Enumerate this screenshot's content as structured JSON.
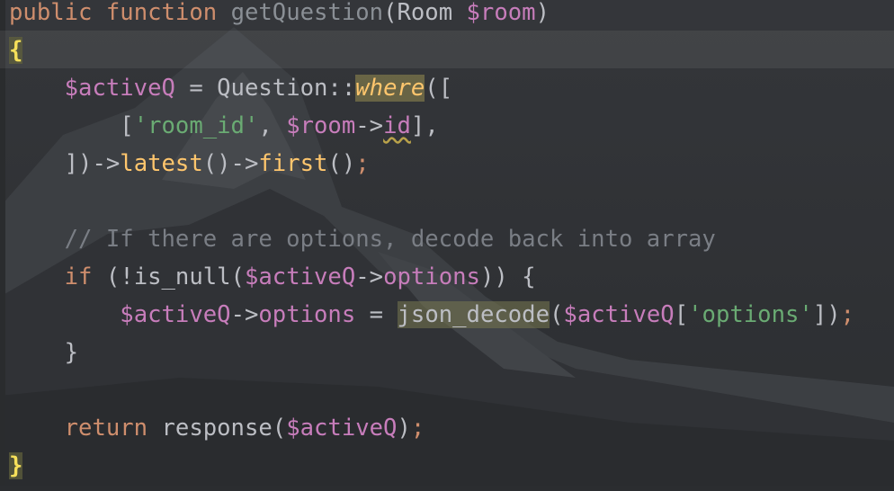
{
  "editor": {
    "lines": [
      {
        "tokens": [
          {
            "t": "public ",
            "c": "kw"
          },
          {
            "t": "function ",
            "c": "kw"
          },
          {
            "t": "getQuestion",
            "c": "fn-decl"
          },
          {
            "t": "(Room ",
            "c": ""
          },
          {
            "t": "$room",
            "c": "var"
          },
          {
            "t": ")",
            "c": ""
          }
        ]
      },
      {
        "tokens": [
          {
            "t": "{",
            "c": "brace"
          }
        ]
      },
      {
        "tokens": [
          {
            "t": "    ",
            "c": ""
          },
          {
            "t": "$activeQ",
            "c": "var"
          },
          {
            "t": " = Question::",
            "c": ""
          },
          {
            "t": "where",
            "c": "call-hl"
          },
          {
            "t": "([",
            "c": ""
          }
        ]
      },
      {
        "tokens": [
          {
            "t": "        [",
            "c": ""
          },
          {
            "t": "'room_id'",
            "c": "str"
          },
          {
            "t": ", ",
            "c": ""
          },
          {
            "t": "$room",
            "c": "var"
          },
          {
            "t": "->",
            "c": ""
          },
          {
            "t": "id",
            "c": "prop squig"
          },
          {
            "t": "],",
            "c": ""
          }
        ]
      },
      {
        "tokens": [
          {
            "t": "    ])->",
            "c": ""
          },
          {
            "t": "latest",
            "c": "call"
          },
          {
            "t": "()->",
            "c": ""
          },
          {
            "t": "first",
            "c": "call"
          },
          {
            "t": "()",
            "c": ""
          },
          {
            "t": ";",
            "c": "punct-or"
          }
        ]
      },
      {
        "tokens": []
      },
      {
        "tokens": [
          {
            "t": "    // If there are options, decode back into array",
            "c": "cmt"
          }
        ]
      },
      {
        "tokens": [
          {
            "t": "    ",
            "c": ""
          },
          {
            "t": "if",
            "c": "kw"
          },
          {
            "t": " (!is_null(",
            "c": ""
          },
          {
            "t": "$activeQ",
            "c": "var"
          },
          {
            "t": "->",
            "c": ""
          },
          {
            "t": "options",
            "c": "prop"
          },
          {
            "t": ")) {",
            "c": ""
          }
        ]
      },
      {
        "tokens": [
          {
            "t": "        ",
            "c": ""
          },
          {
            "t": "$activeQ",
            "c": "var"
          },
          {
            "t": "->",
            "c": ""
          },
          {
            "t": "options",
            "c": "prop"
          },
          {
            "t": " = ",
            "c": ""
          },
          {
            "t": "json_decode",
            "c": "hl"
          },
          {
            "t": "(",
            "c": ""
          },
          {
            "t": "$activeQ",
            "c": "var"
          },
          {
            "t": "[",
            "c": ""
          },
          {
            "t": "'options'",
            "c": "str"
          },
          {
            "t": "])",
            "c": ""
          },
          {
            "t": ";",
            "c": "punct-or"
          }
        ]
      },
      {
        "tokens": [
          {
            "t": "    }",
            "c": ""
          }
        ]
      },
      {
        "tokens": []
      },
      {
        "tokens": [
          {
            "t": "    ",
            "c": ""
          },
          {
            "t": "return",
            "c": "kw"
          },
          {
            "t": " response(",
            "c": ""
          },
          {
            "t": "$activeQ",
            "c": "var"
          },
          {
            "t": ")",
            "c": ""
          },
          {
            "t": ";",
            "c": "punct-or"
          }
        ]
      },
      {
        "tokens": [
          {
            "t": "}",
            "c": "brace"
          }
        ]
      }
    ]
  }
}
